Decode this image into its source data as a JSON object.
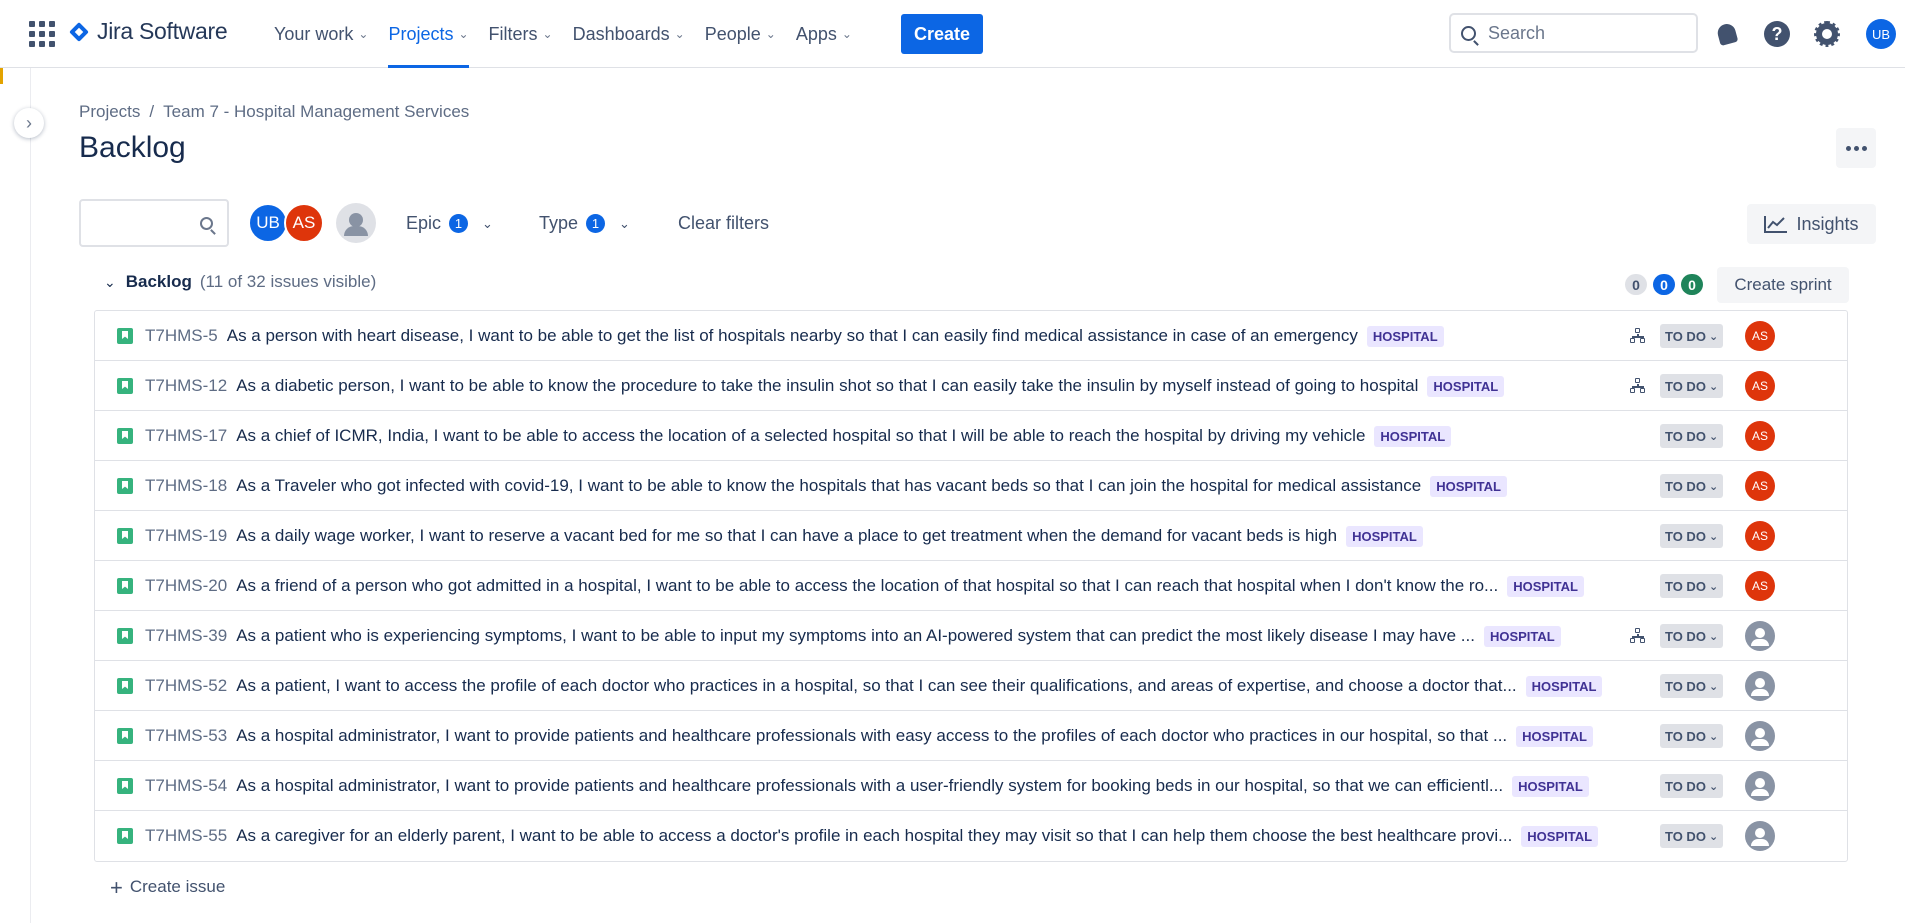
{
  "topbar": {
    "product_name": "Jira Software",
    "nav": [
      {
        "label": "Your work",
        "active": false
      },
      {
        "label": "Projects",
        "active": true
      },
      {
        "label": "Filters",
        "active": false
      },
      {
        "label": "Dashboards",
        "active": false
      },
      {
        "label": "People",
        "active": false
      },
      {
        "label": "Apps",
        "active": false
      }
    ],
    "create_label": "Create",
    "search_placeholder": "Search",
    "user_initials": "UB",
    "help_glyph": "?"
  },
  "breadcrumb": {
    "root": "Projects",
    "separator": "/",
    "project": "Team 7 - Hospital Management Services"
  },
  "page_title": "Backlog",
  "filters": {
    "avatars": [
      {
        "initials": "UB",
        "color": "#0c66e4"
      },
      {
        "initials": "AS",
        "color": "#de350b"
      }
    ],
    "epic_label": "Epic",
    "epic_count": "1",
    "type_label": "Type",
    "type_count": "1",
    "clear_label": "Clear filters",
    "insights_label": "Insights"
  },
  "backlog": {
    "name": "Backlog",
    "visible_text": "(11 of 32 issues visible)",
    "pills": [
      {
        "value": "0",
        "bg": "#dfe1e6",
        "fg": "#42526e"
      },
      {
        "value": "0",
        "bg": "#0c66e4",
        "fg": "#ffffff"
      },
      {
        "value": "0",
        "bg": "#1f845a",
        "fg": "#ffffff"
      }
    ],
    "create_sprint_label": "Create sprint",
    "create_issue_label": "Create issue",
    "issues": [
      {
        "key": "T7HMS-5",
        "summary": "As a person with heart disease, I want to be able to get the list of hospitals nearby so that I can easily find medical assistance in case of an emergency",
        "epic": "HOSPITAL",
        "has_children": true,
        "status": "TO DO",
        "assignee": "AS"
      },
      {
        "key": "T7HMS-12",
        "summary": "As a diabetic person, I want to be able to know the procedure to take the insulin shot so that I can easily take the insulin by myself instead of going to hospital",
        "epic": "HOSPITAL",
        "has_children": true,
        "status": "TO DO",
        "assignee": "AS"
      },
      {
        "key": "T7HMS-17",
        "summary": "As a chief of ICMR, India, I want to be able to access the location of a selected hospital so that I will be able to reach the hospital by driving my vehicle",
        "epic": "HOSPITAL",
        "has_children": false,
        "status": "TO DO",
        "assignee": "AS"
      },
      {
        "key": "T7HMS-18",
        "summary": "As a Traveler who got infected with covid-19, I want to be able to know the hospitals that has vacant beds so that I can join the hospital for medical assistance",
        "epic": "HOSPITAL",
        "has_children": false,
        "status": "TO DO",
        "assignee": "AS"
      },
      {
        "key": "T7HMS-19",
        "summary": "As a daily wage worker, I want to reserve a vacant bed for me so that I can have a place to get treatment when the demand for vacant beds is high",
        "epic": "HOSPITAL",
        "has_children": false,
        "status": "TO DO",
        "assignee": "AS"
      },
      {
        "key": "T7HMS-20",
        "summary": "As a friend of a person who got admitted in a hospital, I want to be able to access the location of that hospital so that I can reach that hospital when I don't know the ro...",
        "epic": "HOSPITAL",
        "has_children": false,
        "status": "TO DO",
        "assignee": "AS"
      },
      {
        "key": "T7HMS-39",
        "summary": "As a patient who is experiencing symptoms, I want to be able to input my symptoms into an AI-powered system that can predict the most likely disease I may have ...",
        "epic": "HOSPITAL",
        "has_children": true,
        "status": "TO DO",
        "assignee": ""
      },
      {
        "key": "T7HMS-52",
        "summary": "As a patient, I want to access the profile of each doctor who practices in a hospital, so that I can see their qualifications, and areas of expertise, and choose a doctor that...",
        "epic": "HOSPITAL",
        "has_children": false,
        "status": "TO DO",
        "assignee": ""
      },
      {
        "key": "T7HMS-53",
        "summary": "As a hospital administrator, I want to provide patients and healthcare professionals with easy access to the profiles of each doctor who practices in our hospital, so that ...",
        "epic": "HOSPITAL",
        "has_children": false,
        "status": "TO DO",
        "assignee": ""
      },
      {
        "key": "T7HMS-54",
        "summary": "As a hospital administrator, I want to provide patients and healthcare professionals with a user-friendly system for booking beds in our hospital, so that we can efficientl...",
        "epic": "HOSPITAL",
        "has_children": false,
        "status": "TO DO",
        "assignee": ""
      },
      {
        "key": "T7HMS-55",
        "summary": "As a caregiver for an elderly parent, I want to be able to access a doctor's profile in each hospital they may visit so that I can help them choose the best healthcare provi...",
        "epic": "HOSPITAL",
        "has_children": false,
        "status": "TO DO",
        "assignee": ""
      }
    ]
  }
}
